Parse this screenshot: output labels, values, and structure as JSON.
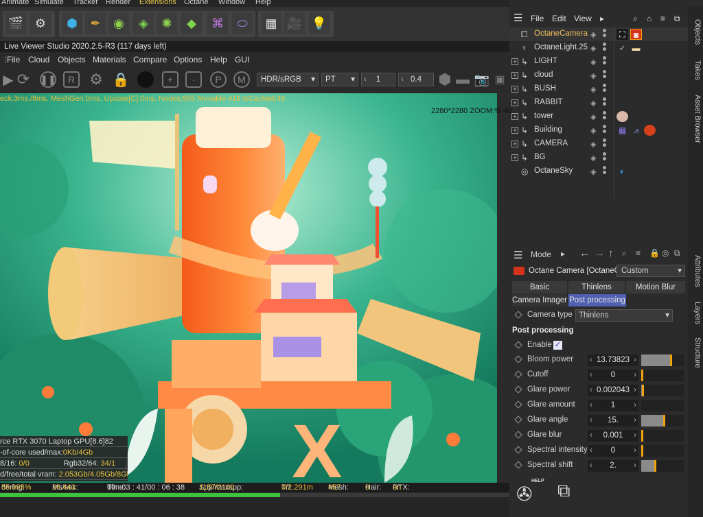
{
  "top_menu": [
    "Animate",
    "Simulate",
    "Tracker",
    "Render",
    "Extensions",
    "Octane",
    "Window",
    "Help"
  ],
  "title": "Live Viewer Studio 2020.2.5-R3 (117 days left)",
  "lv_menu": [
    "File",
    "Cloud",
    "Objects",
    "Materials",
    "Compare",
    "Options",
    "Help",
    "GUI"
  ],
  "lv_toolbar": {
    "color_space": "HDR/sRGB",
    "kernel": "PT",
    "value_1": "1",
    "value_2": "0.4"
  },
  "viewport": {
    "stats": "eck:3ms./8ms. MeshGen:0ms. Update[C]:0ms. Nodes:955 Movable:418 txCached:49",
    "resolution": "2280*2280 ZOOM:%:40"
  },
  "gpu_info": {
    "row1": "rce RTX 3070 Laptop GPU[",
    "row1_tag": "8.6",
    "row1_val": "82",
    "row2_label": "-of-core used/max:",
    "row2_val": "0Kb/4Gb",
    "row3_label": "8/16: ",
    "row3_val": "0/0",
    "row3_label2": "Rgb32/64: ",
    "row3_val2": "34/1",
    "row4_label": "d/free/total vram: ",
    "row4_val": "2.053Gb/4.05Gb/8Gb"
  },
  "status": {
    "rendering_label": "dering: ",
    "rendering": "55.095%",
    "mssec_label": "Ms/sec: ",
    "mssec": "26.443",
    "time_label": "Time: ",
    "time": "00 : 03 : 41/00 : 06 : 38",
    "spp_label": "Spp/maxspp: ",
    "spp": "1157/2100",
    "tri_label": "Tri: ",
    "tri": "0/2.291m",
    "mesh_label": "Mesh: ",
    "mesh": "457",
    "hair_label": "Hair: ",
    "hair": "0",
    "rtx_label": "RTX:",
    "rtx": "on",
    "progress": 0.55
  },
  "objects_panel": {
    "menu": [
      "File",
      "Edit",
      "View"
    ],
    "items": [
      {
        "name": "OctaneCamera",
        "highlight": true,
        "icon": "camera-icon"
      },
      {
        "name": "OctaneLight.25",
        "icon": "light-icon"
      },
      {
        "name": "LIGHT",
        "icon": "null-icon"
      },
      {
        "name": "cloud",
        "icon": "null-icon"
      },
      {
        "name": "BUSH",
        "icon": "null-icon"
      },
      {
        "name": "RABBIT",
        "icon": "null-icon"
      },
      {
        "name": "tower",
        "icon": "null-icon"
      },
      {
        "name": "Building",
        "icon": "null-icon"
      },
      {
        "name": "CAMERA",
        "icon": "null-icon"
      },
      {
        "name": "BG",
        "icon": "null-icon"
      },
      {
        "name": "OctaneSky",
        "icon": "sky-icon"
      }
    ]
  },
  "side_tabs": [
    "Objects",
    "Takes",
    "Asset Browser",
    "Attributes",
    "Layers",
    "Structure"
  ],
  "attributes_panel": {
    "mode": "Mode",
    "object_title": "Octane Camera [OctaneC",
    "preset": "Custom",
    "tabs_row1": [
      "Basic",
      "Thinlens",
      "Motion Blur"
    ],
    "tabs_row2": [
      "Camera Imager",
      "Post processing"
    ],
    "camera_type_label": "Camera type",
    "camera_type": "Thinlens",
    "section": "Post processing",
    "enable_label": "Enable",
    "params": [
      {
        "label": "Bloom power",
        "value": "13.73823",
        "fill": 0.72,
        "mark": 0.72
      },
      {
        "label": "Cutoff",
        "value": "0",
        "fill": 0,
        "mark": 0
      },
      {
        "label": "Glare power",
        "value": "0.002043",
        "fill": 0.02,
        "mark": 0.02
      },
      {
        "label": "Glare amount",
        "value": "1",
        "fill": 0,
        "mark": null
      },
      {
        "label": "Glare angle",
        "value": "15.",
        "fill": 0.55,
        "mark": 0.55
      },
      {
        "label": "Glare blur",
        "value": "0.001",
        "fill": 0,
        "mark": 0
      },
      {
        "label": "Spectral intensity",
        "value": "0",
        "fill": 0,
        "mark": 0
      },
      {
        "label": "Spectral shift",
        "value": "2.",
        "fill": 0.32,
        "mark": 0.32
      }
    ],
    "help_label": "HELP"
  },
  "colors": {
    "accent": "#f2a20c",
    "highlight_text": "#f0c060",
    "progress": "#3ec33e",
    "stats": "#e8c040"
  }
}
